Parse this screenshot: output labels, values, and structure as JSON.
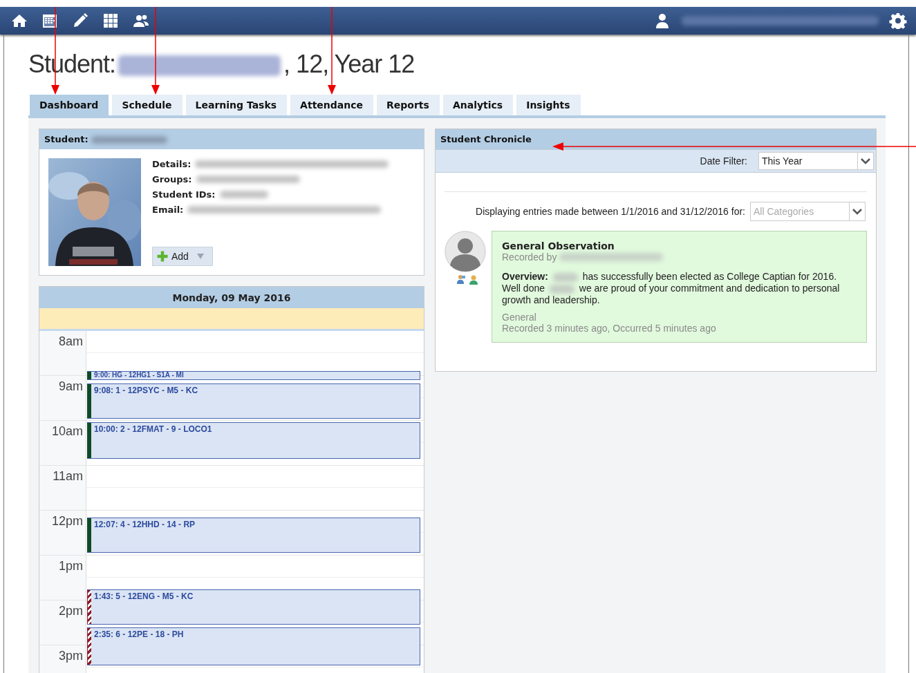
{
  "title": {
    "parts": [
      "Student:",
      ", 12, Year 12"
    ]
  },
  "tabs": [
    {
      "label": "Dashboard",
      "selected": true,
      "marked": true
    },
    {
      "label": "Schedule",
      "selected": false,
      "marked": true
    },
    {
      "label": "Learning Tasks",
      "selected": false,
      "marked": false
    },
    {
      "label": "Attendance",
      "selected": false,
      "marked": true
    },
    {
      "label": "Reports",
      "selected": false,
      "marked": false
    },
    {
      "label": "Analytics",
      "selected": false,
      "marked": false
    },
    {
      "label": "Insights",
      "selected": false,
      "marked": false
    }
  ],
  "student_card": {
    "header": "Student:",
    "fields": [
      {
        "label": "Details:"
      },
      {
        "label": "Groups:"
      },
      {
        "label": "Student IDs:"
      },
      {
        "label": "Email:"
      }
    ],
    "add_button": "Add"
  },
  "calendar": {
    "date": "Monday, 09 May 2016",
    "hours": [
      "8am",
      "9am",
      "10am",
      "11am",
      "12pm",
      "1pm",
      "2pm",
      "3pm"
    ],
    "events": [
      {
        "label": "9:00: HG - 12HG1 - S1A - MI",
        "kind": "solid"
      },
      {
        "label": "9:08: 1 - 12PSYC - M5 - KC",
        "kind": "solid"
      },
      {
        "label": "10:00: 2 - 12FMAT - 9 - LOCO1",
        "kind": "solid"
      },
      {
        "label": "12:07: 4 - 12HHD - 14 - RP",
        "kind": "solid"
      },
      {
        "label": "1:43: 5 - 12ENG - M5 - KC",
        "kind": "striped"
      },
      {
        "label": "2:35: 6 - 12PE - 18 - PH",
        "kind": "striped"
      }
    ]
  },
  "chronicle": {
    "title": "Student Chronicle",
    "marked": true,
    "date_filter": {
      "label": "Date Filter:",
      "value": "This Year"
    },
    "range_text": "Displaying entries made between 1/1/2016 and 31/12/2016 for:",
    "category_select": {
      "placeholder": "All Categories"
    },
    "entries": [
      {
        "title": "General Observation",
        "recorded_by": "Recorded by",
        "overview_parts": [
          "**Overview:** ",
          " has successfully been elected as College Captian for 2016. Well done ",
          " we are proud of your commitment and dedication to personal growth and leadership."
        ],
        "category": "General",
        "times": "Recorded 3 minutes ago, Occurred 5 minutes ago"
      }
    ]
  }
}
